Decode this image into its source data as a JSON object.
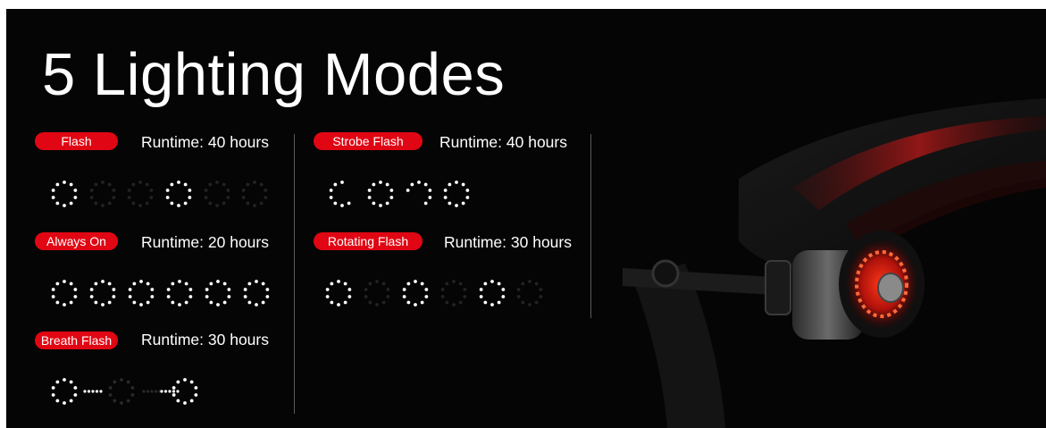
{
  "title": "5 Lighting Modes",
  "accent_color": "#e10613",
  "modes": [
    {
      "name": "Flash",
      "runtime": "Runtime: 40 hours",
      "pattern": "flash-pattern"
    },
    {
      "name": "Always On",
      "runtime": "Runtime: 20 hours",
      "pattern": "always-on-pattern"
    },
    {
      "name": "Breath Flash",
      "runtime": "Runtime: 30 hours",
      "pattern": "breath-flash-pattern"
    },
    {
      "name": "Strobe Flash",
      "runtime": "Runtime: 40 hours",
      "pattern": "strobe-flash-pattern"
    },
    {
      "name": "Rotating Flash",
      "runtime": "Runtime: 30 hours",
      "pattern": "rotating-flash-pattern"
    }
  ]
}
